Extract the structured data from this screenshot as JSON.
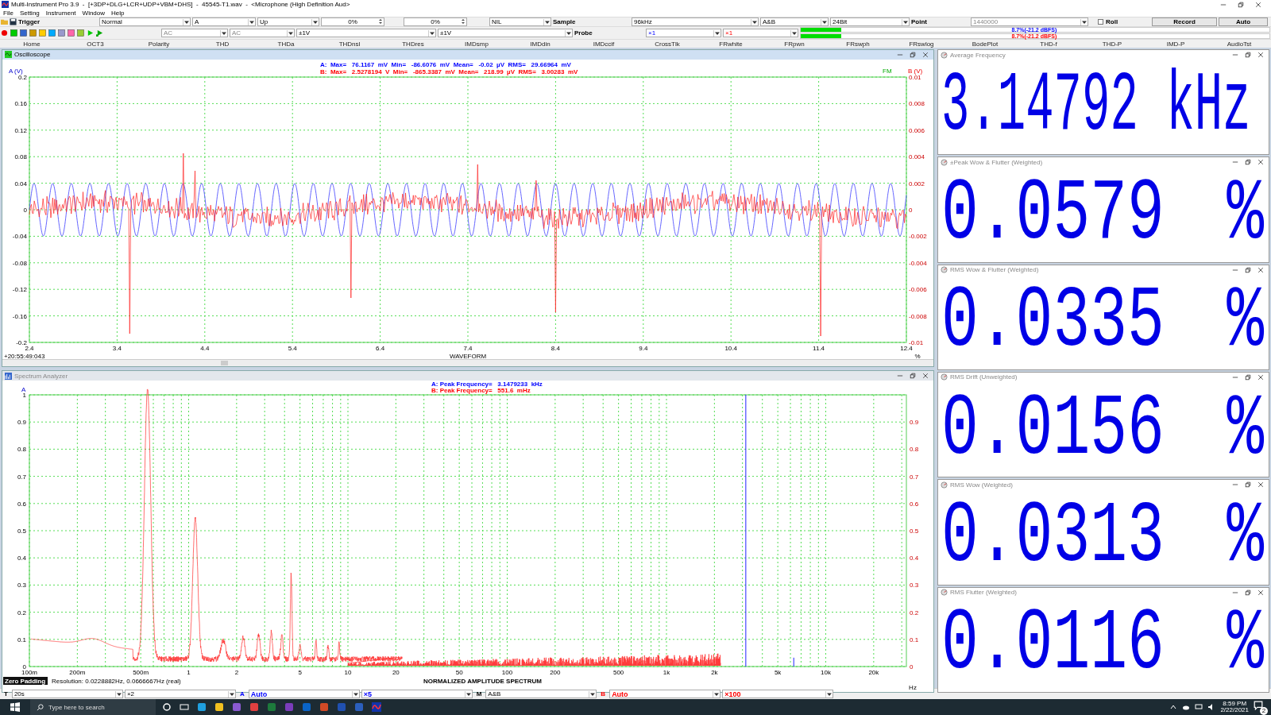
{
  "window": {
    "title": "Multi-Instrument Pro 3.9  -  [+3DP+DLG+LCR+UDP+VBM+DHS]  -  45545-T1.wav  -  <Microphone (High Definition Aud>"
  },
  "menu": [
    "File",
    "Setting",
    "Instrument",
    "Window",
    "Help"
  ],
  "toolbar": {
    "trigger_label": "Trigger",
    "trigger_mode": "Normal",
    "trigger_channel": "A",
    "trigger_edge": "Up",
    "trigger_level": "0%",
    "trigger_delay": "0%",
    "trigger_source": "NIL",
    "sample_label": "Sample",
    "sample_rate": "96kHz",
    "channels": "A&B",
    "bit_depth": "24Bit",
    "point_label": "Point",
    "points": "1440000",
    "roll": {
      "label": "Roll",
      "checked": false
    },
    "record_button": "Record",
    "auto_button": "Auto"
  },
  "toolbar2": {
    "coupling_a": "AC",
    "coupling_b": "AC",
    "range_a": "±1V",
    "range_b": "±1V",
    "probe_label": "Probe",
    "probe_a": "×1",
    "probe_b": "×1",
    "meters": [
      {
        "level": 0.087,
        "reading": "8.7%(-21.2 dBFS)",
        "color": "#0000ff"
      },
      {
        "level": 0.087,
        "reading": "8.7%(-21.2 dBFS)",
        "color": "#ff0000"
      }
    ]
  },
  "tabs": [
    "Home",
    "OCT3",
    "Polarity",
    "THD",
    "THDa",
    "THDnsl",
    "THDres",
    "IMDsmp",
    "IMDdin",
    "IMDccif",
    "CrossTlk",
    "FRwhite",
    "FRpwn",
    "FRswph",
    "FRswlog",
    "BodePlot",
    "THD-f",
    "THD-P",
    "IMD-P",
    "AudioTst"
  ],
  "oscilloscope": {
    "title": "Oscilloscope",
    "y_label_a": "A (V)",
    "y_label_b": "B (V)",
    "fm_label": "FM",
    "stats": [
      {
        "text": "A:  Max=   76.1167  mV  Min=   -86.6076  mV  Mean=   -0.02  µV  RMS=   29.66964  mV",
        "color": "#0000ff"
      },
      {
        "text": "B:  Max=   2.5278194  V  Min=   -865.3387  mV  Mean=   218.99  µV  RMS=   3.00283  mV",
        "color": "#ff0000"
      }
    ],
    "yticks_a": [
      "0.2",
      "0.16",
      "0.12",
      "0.08",
      "0.04",
      "0",
      "-0.04",
      "-0.08",
      "-0.12",
      "-0.16",
      "-0.2"
    ],
    "yticks_b": [
      "0.01",
      "0.008",
      "0.006",
      "0.004",
      "0.002",
      "0",
      "-0.002",
      "-0.004",
      "-0.006",
      "-0.008",
      "-0.01"
    ],
    "xticks": [
      "2.4",
      "3.4",
      "4.4",
      "5.4",
      "6.4",
      "7.4",
      "8.4",
      "9.4",
      "10.4",
      "11.4",
      "12.4"
    ],
    "x_title": "WAVEFORM",
    "timestamp": "+20:55:49:043",
    "x_unit": "%"
  },
  "spectrum": {
    "title": "Spectrum Analyzer",
    "y_label_a": "A",
    "stats": [
      {
        "text": "A: Peak Frequency=   3.1479233  kHz",
        "color": "#0000ff"
      },
      {
        "text": "B: Peak Frequency=   551.6  mHz",
        "color": "#ff0000"
      }
    ],
    "yticks_a": [
      "1",
      "0.9",
      "0.8",
      "0.7",
      "0.6",
      "0.5",
      "0.4",
      "0.3",
      "0.2",
      "0.1",
      "0"
    ],
    "yticks_b": [
      "0.9",
      "0.8",
      "0.7",
      "0.6",
      "0.5",
      "0.4",
      "0.3",
      "0.2",
      "0.1",
      "0"
    ],
    "xticks": [
      "100m",
      "200m",
      "500m",
      "1",
      "2",
      "5",
      "10",
      "20",
      "50",
      "100",
      "200",
      "500",
      "1k",
      "2k",
      "5k",
      "10k",
      "20k"
    ],
    "zero_padding": "Zero Padding",
    "resolution": "Resolution: 0.0228882Hz, 0.0666667Hz (real)",
    "x_title": "NORMALIZED AMPLITUDE SPECTRUM",
    "x_unit": "Hz"
  },
  "meters": [
    {
      "title": "Average Frequency",
      "value": "3.14792 kHz"
    },
    {
      "title": "±Peak Wow & Flutter (Weighted)",
      "value": "0.0579",
      "unit": "%"
    },
    {
      "title": "RMS Wow & Flutter (Weighted)",
      "value": "0.0335",
      "unit": "%"
    },
    {
      "title": "RMS Drift (Unweighted)",
      "value": "0.0156",
      "unit": "%"
    },
    {
      "title": "RMS Wow (Weighted)",
      "value": "0.0313",
      "unit": "%"
    },
    {
      "title": "RMS Flutter (Weighted)",
      "value": "0.0116",
      "unit": "%"
    }
  ],
  "controls": [
    {
      "kind": "label",
      "text": "T"
    },
    {
      "kind": "combo",
      "text": "20s"
    },
    {
      "kind": "combo",
      "text": "×2"
    },
    {
      "kind": "label",
      "text": "A",
      "color": "#0000ff"
    },
    {
      "kind": "combo",
      "text": "Auto",
      "color": "#0000ff"
    },
    {
      "kind": "combo",
      "text": "×5",
      "color": "#0000ff"
    },
    {
      "kind": "label",
      "text": "M"
    },
    {
      "kind": "combo",
      "text": "A&B"
    },
    {
      "kind": "label",
      "text": "B",
      "color": "#ff0000"
    },
    {
      "kind": "combo",
      "text": "Auto",
      "color": "#ff0000"
    },
    {
      "kind": "combo",
      "text": "×100",
      "color": "#ff0000"
    }
  ],
  "taskbar": {
    "search_placeholder": "Type here to search",
    "time": "8:59 PM",
    "date": "2/22/2021",
    "notifications": "2"
  }
}
